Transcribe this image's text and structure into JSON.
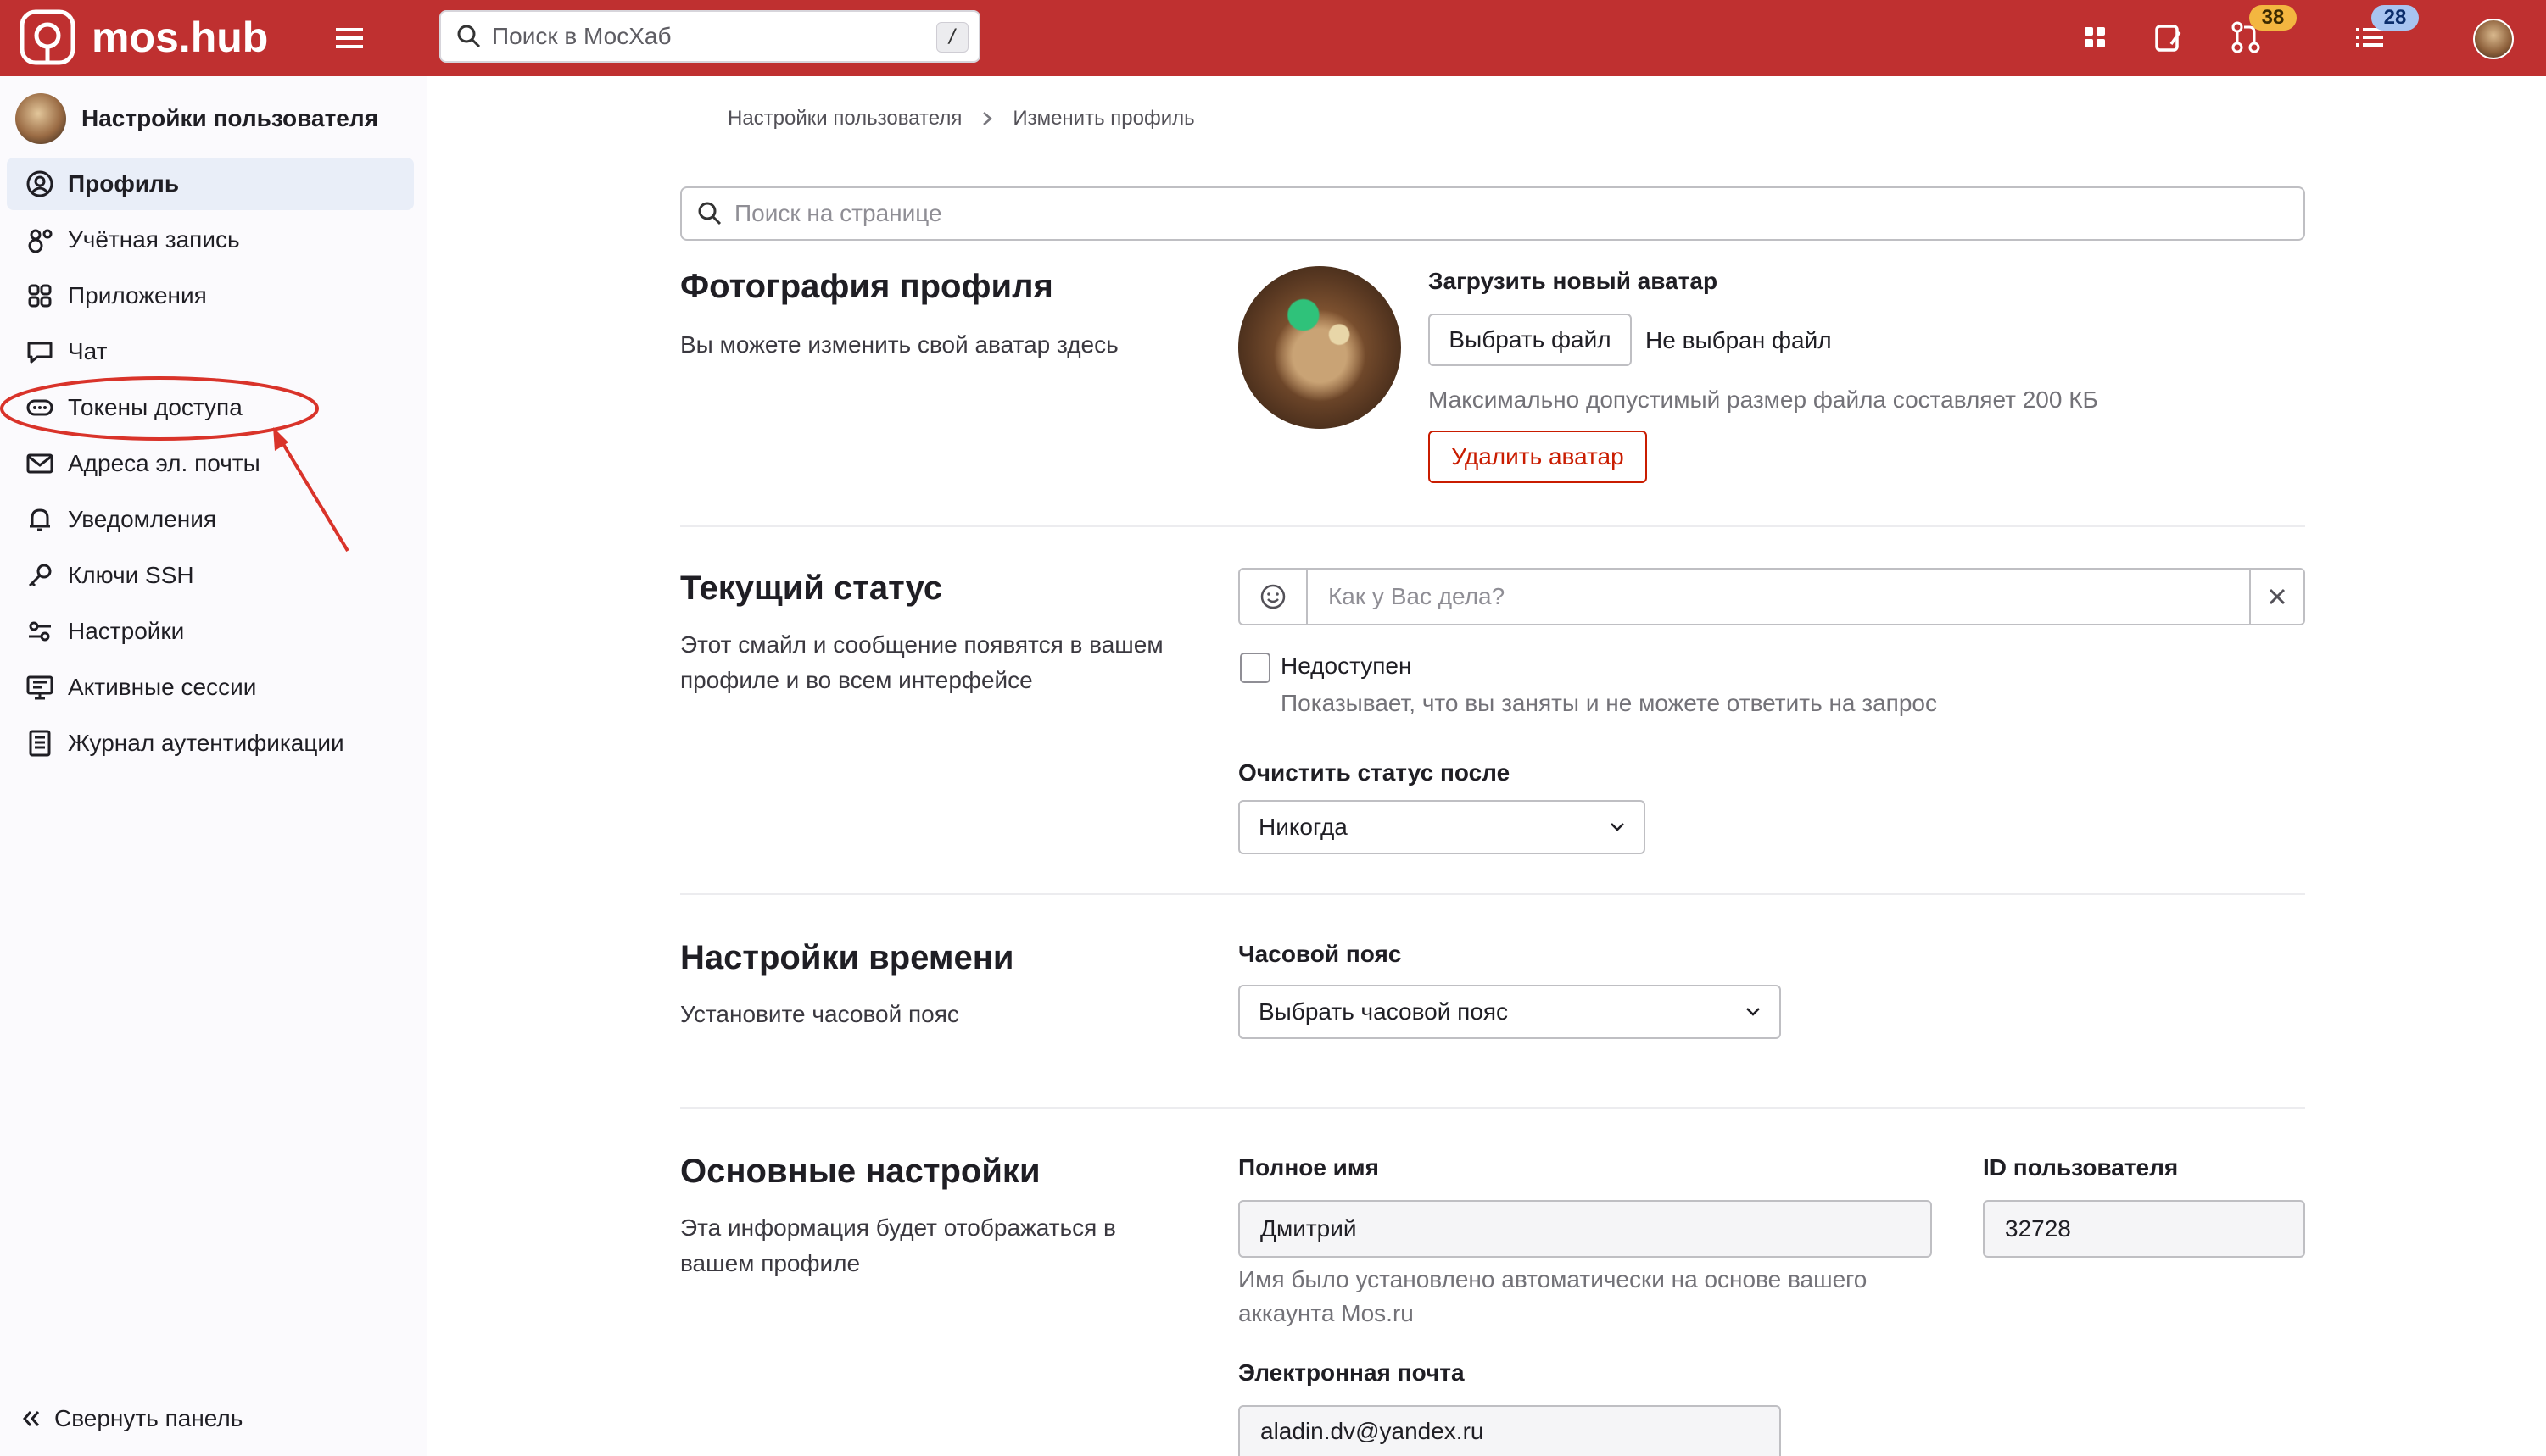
{
  "header": {
    "logo_text": "mos.hub",
    "search_placeholder": "Поиск в МосХаб",
    "search_shortcut": "/",
    "merge_requests_count": "38",
    "todos_count": "28",
    "colors": {
      "bar": "#bf3030",
      "badge_orange": "#f3b640",
      "badge_blue": "#a8c4f0"
    }
  },
  "sidebar": {
    "title": "Настройки пользователя",
    "items": [
      {
        "label": "Профиль",
        "icon": "profile-icon",
        "active": true
      },
      {
        "label": "Учётная запись",
        "icon": "account-icon"
      },
      {
        "label": "Приложения",
        "icon": "applications-icon"
      },
      {
        "label": "Чат",
        "icon": "chat-icon"
      },
      {
        "label": "Токены доступа",
        "icon": "token-icon"
      },
      {
        "label": "Адреса эл. почты",
        "icon": "mail-icon"
      },
      {
        "label": "Уведомления",
        "icon": "bell-icon"
      },
      {
        "label": "Ключи SSH",
        "icon": "key-icon"
      },
      {
        "label": "Настройки",
        "icon": "preferences-icon"
      },
      {
        "label": "Активные сессии",
        "icon": "monitor-icon"
      },
      {
        "label": "Журнал аутентификации",
        "icon": "log-icon"
      }
    ],
    "collapse_label": "Свернуть панель"
  },
  "breadcrumb": {
    "parent": "Настройки пользователя",
    "current": "Изменить профиль"
  },
  "page_search_placeholder": "Поиск на странице",
  "photo": {
    "title": "Фотография профиля",
    "description": "Вы можете изменить свой аватар здесь",
    "upload_label": "Загрузить новый аватар",
    "choose_file": "Выбрать файл",
    "no_file": "Не выбран файл",
    "max_size": "Максимально допустимый размер файла составляет 200 КБ",
    "remove": "Удалить аватар"
  },
  "status": {
    "title": "Текущий статус",
    "description": "Этот смайл и сообщение появятся в вашем профиле и во всем интерфейсе",
    "placeholder": "Как у Вас дела?",
    "busy_label": "Недоступен",
    "busy_help": "Показывает, что вы заняты и не можете ответить на запрос",
    "clear_label": "Очистить статус после",
    "clear_value": "Никогда"
  },
  "time": {
    "title": "Настройки времени",
    "description": "Установите часовой пояс",
    "tz_label": "Часовой пояс",
    "tz_value": "Выбрать часовой пояс"
  },
  "main": {
    "title": "Основные настройки",
    "description": "Эта информация будет отображаться в вашем профиле",
    "name_label": "Полное имя",
    "name_value": "Дмитрий",
    "name_help": "Имя было установлено автоматически на основе вашего аккаунта Mos.ru",
    "id_label": "ID пользователя",
    "id_value": "32728",
    "email_label": "Электронная почта",
    "email_value": "aladin.dv@yandex.ru"
  }
}
